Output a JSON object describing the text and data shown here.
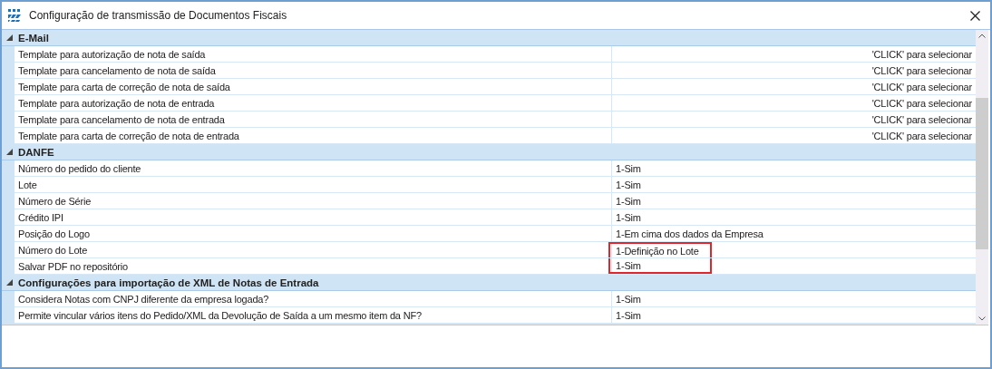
{
  "window": {
    "title": "Configuração de transmissão de Documentos Fiscais"
  },
  "sections": [
    {
      "title": "E-Mail",
      "expanded": true,
      "rows": [
        {
          "label": "Template para autorização de nota de saída",
          "kind": "selector",
          "value": "'CLICK' para selecionar",
          "highlighted": false
        },
        {
          "label": "Template para cancelamento de nota de saída",
          "kind": "selector",
          "value": "'CLICK' para selecionar",
          "highlighted": false
        },
        {
          "label": "Template para carta de correção de nota de saída",
          "kind": "selector",
          "value": "'CLICK' para selecionar",
          "highlighted": false
        },
        {
          "label": "Template para autorização de nota de entrada",
          "kind": "selector",
          "value": "'CLICK' para selecionar",
          "highlighted": false
        },
        {
          "label": "Template para cancelamento de nota de entrada",
          "kind": "selector",
          "value": "'CLICK' para selecionar",
          "highlighted": false
        },
        {
          "label": "Template para carta de correção de nota de entrada",
          "kind": "selector",
          "value": "'CLICK' para selecionar",
          "highlighted": false
        }
      ]
    },
    {
      "title": "DANFE",
      "expanded": true,
      "rows": [
        {
          "label": "Número do pedido do cliente",
          "kind": "value",
          "value": "1-Sim",
          "highlighted": false
        },
        {
          "label": "Lote",
          "kind": "value",
          "value": "1-Sim",
          "highlighted": false
        },
        {
          "label": "Número de Série",
          "kind": "value",
          "value": "1-Sim",
          "highlighted": false
        },
        {
          "label": "Crédito IPI",
          "kind": "value",
          "value": "1-Sim",
          "highlighted": false
        },
        {
          "label": "Posição do Logo",
          "kind": "value",
          "value": "1-Em cima dos dados da Empresa",
          "highlighted": false
        },
        {
          "label": "Número do Lote",
          "kind": "value",
          "value": "1-Definição no Lote",
          "highlighted": true
        },
        {
          "label": "Salvar PDF no repositório",
          "kind": "value",
          "value": "1-Sim",
          "highlighted": true
        }
      ]
    },
    {
      "title": "Configurações para importação de XML de Notas de Entrada",
      "expanded": true,
      "rows": [
        {
          "label": "Considera Notas com CNPJ diferente da empresa logada?",
          "kind": "value",
          "value": "1-Sim",
          "highlighted": false
        },
        {
          "label": "Permite vincular vários itens do Pedido/XML da Devolução de Saída a um mesmo item da NF?",
          "kind": "value",
          "value": "1-Sim",
          "highlighted": false
        }
      ]
    }
  ]
}
